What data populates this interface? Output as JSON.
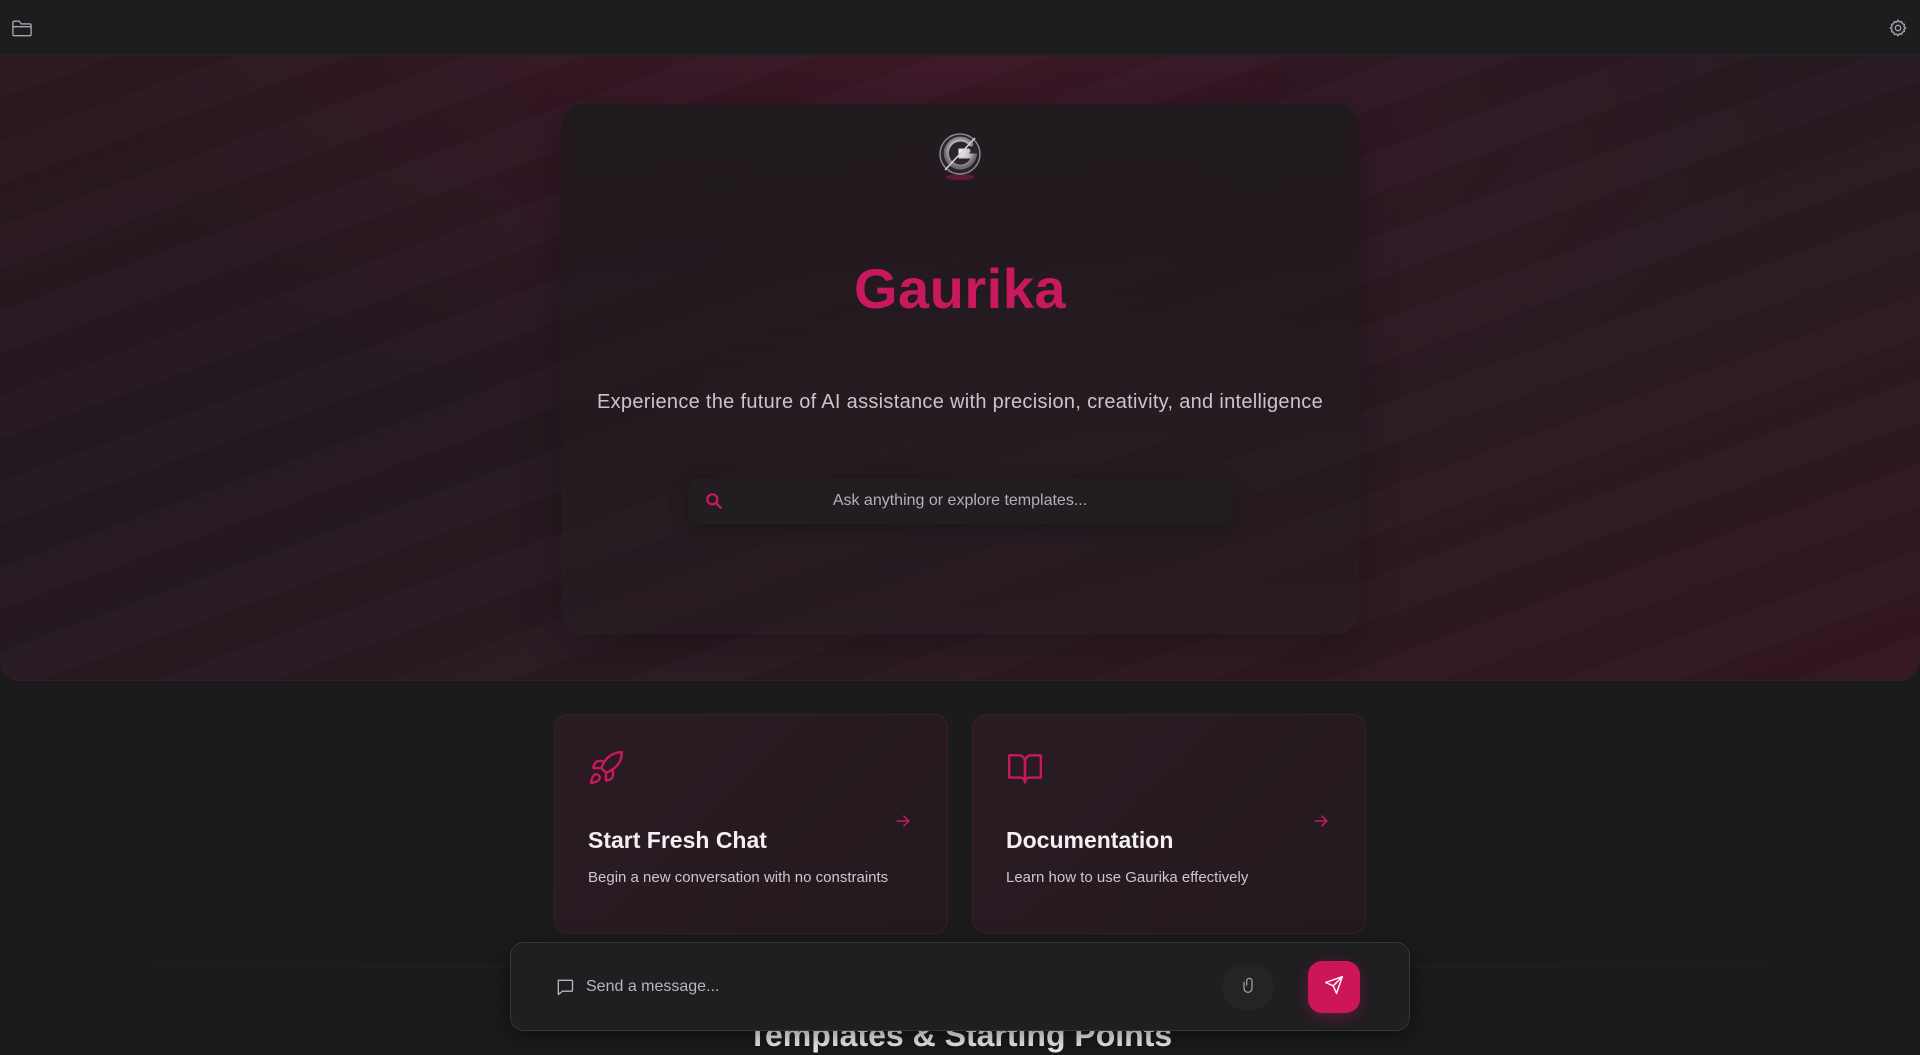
{
  "topbar": {
    "left_icon": "folder-icon",
    "right_icon": "gear-icon"
  },
  "hero": {
    "brand": "Gaurika",
    "tagline": "Experience the future of AI assistance with precision, creativity, and intelligence",
    "search": {
      "placeholder": "Ask anything or explore templates..."
    }
  },
  "features": [
    {
      "icon": "rocket-icon",
      "title": "Start Fresh Chat",
      "description": "Begin a new conversation with no constraints"
    },
    {
      "icon": "book-icon",
      "title": "Documentation",
      "description": "Learn how to use Gaurika effectively"
    }
  ],
  "section": {
    "title": "Templates & Starting Points"
  },
  "composer": {
    "placeholder": "Send a message..."
  },
  "colors": {
    "accent": "#c8195f",
    "send_button": "#cc1657",
    "background": "#1b1a1c"
  }
}
